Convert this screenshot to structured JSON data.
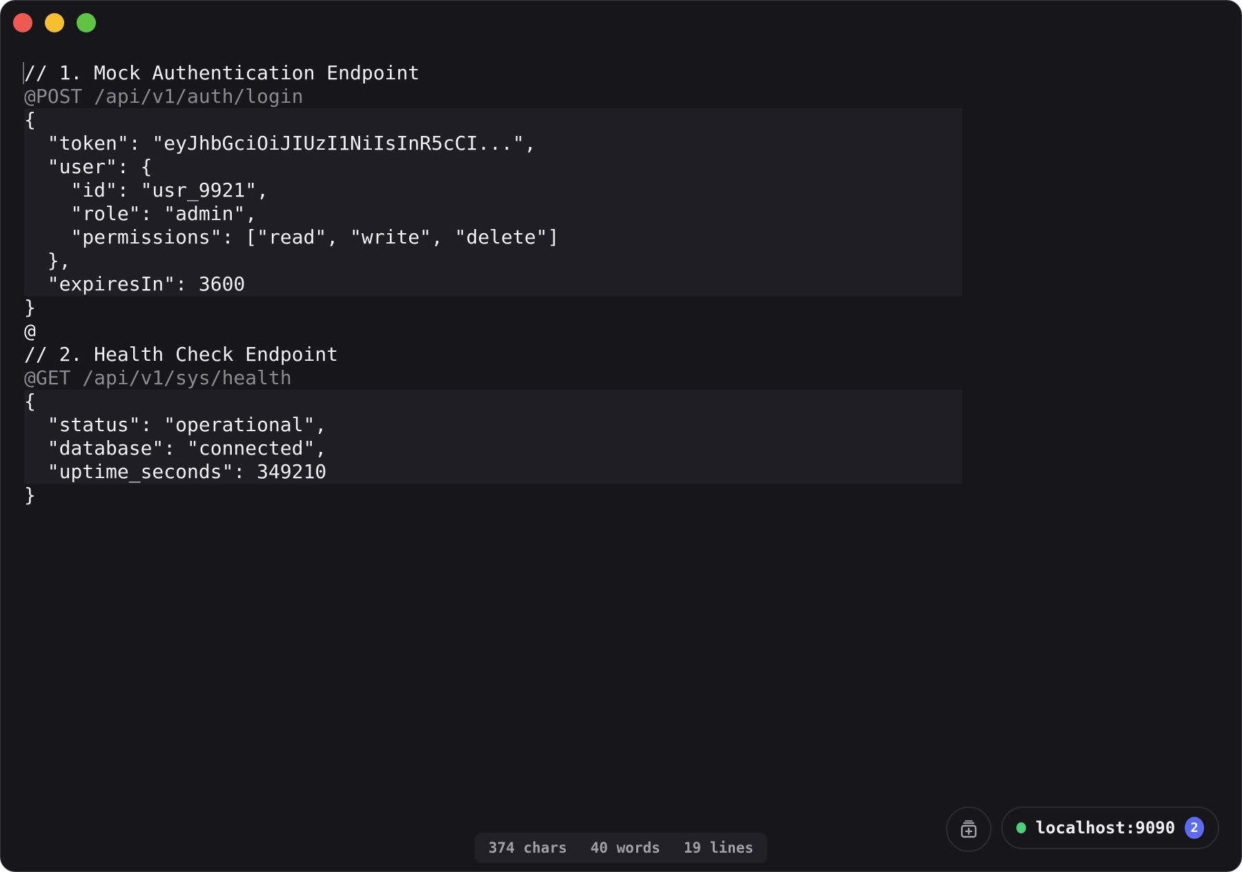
{
  "window": {
    "controls": [
      "close",
      "minimize",
      "zoom"
    ]
  },
  "editor": {
    "lines": [
      {
        "text": "// 1. Mock Authentication Endpoint",
        "kind": "comment"
      },
      {
        "text": "@POST /api/v1/auth/login",
        "kind": "meta"
      },
      {
        "text": "{",
        "kind": "body"
      },
      {
        "text": "  \"token\": \"eyJhbGciOiJIUzI1NiIsInR5cCI...\",",
        "kind": "body"
      },
      {
        "text": "  \"user\": {",
        "kind": "body"
      },
      {
        "text": "    \"id\": \"usr_9921\",",
        "kind": "body"
      },
      {
        "text": "    \"role\": \"admin\",",
        "kind": "body"
      },
      {
        "text": "    \"permissions\": [\"read\", \"write\", \"delete\"]",
        "kind": "body"
      },
      {
        "text": "  },",
        "kind": "body"
      },
      {
        "text": "  \"expiresIn\": 3600",
        "kind": "body"
      },
      {
        "text": "}",
        "kind": "plain"
      },
      {
        "text": "@",
        "kind": "plain"
      },
      {
        "text": "// 2. Health Check Endpoint",
        "kind": "comment"
      },
      {
        "text": "@GET /api/v1/sys/health",
        "kind": "meta"
      },
      {
        "text": "{",
        "kind": "body"
      },
      {
        "text": "  \"status\": \"operational\",",
        "kind": "body"
      },
      {
        "text": "  \"database\": \"connected\",",
        "kind": "body"
      },
      {
        "text": "  \"uptime_seconds\": 349210",
        "kind": "body"
      },
      {
        "text": "}",
        "kind": "plain"
      }
    ]
  },
  "stats": {
    "chars": "374 chars",
    "words": "40 words",
    "lines": "19 lines"
  },
  "server": {
    "label": "localhost:9090",
    "badge_count": "2",
    "status_color": "#4cd07a",
    "badge_color": "#5b6cf0"
  },
  "icons": {
    "side_button": "new-snippet-icon",
    "status": "status-dot"
  }
}
